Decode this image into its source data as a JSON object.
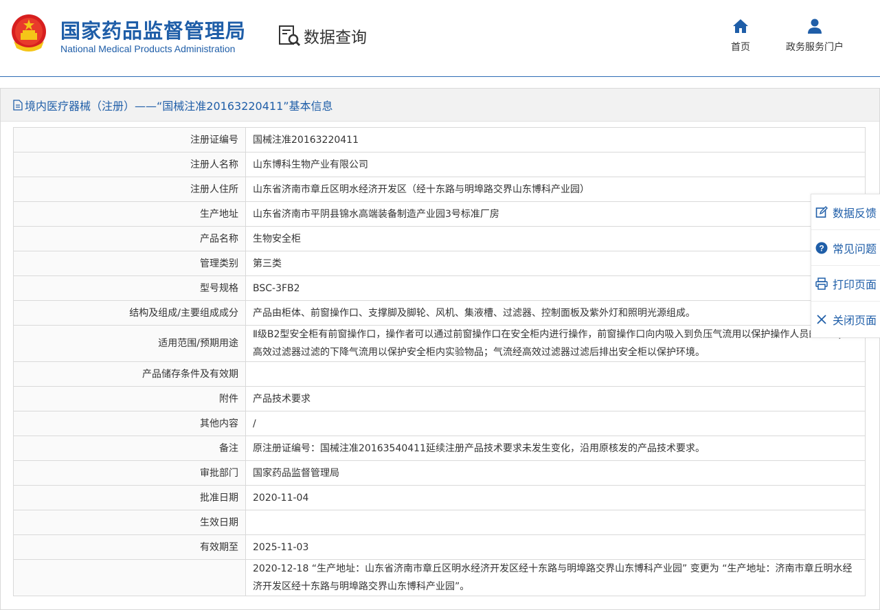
{
  "header": {
    "org_cn": "国家药品监督管理局",
    "org_en": "National Medical Products Administration",
    "query_label": "数据查询",
    "nav": [
      {
        "label": "首页",
        "icon": "home-icon"
      },
      {
        "label": "政务服务门户",
        "icon": "user-icon"
      }
    ]
  },
  "panel": {
    "title": "境内医疗器械（注册）——“国械注准20163220411”基本信息"
  },
  "rows": [
    {
      "key": "注册证编号",
      "value": "国械注准20163220411"
    },
    {
      "key": "注册人名称",
      "value": "山东博科生物产业有限公司"
    },
    {
      "key": "注册人住所",
      "value": "山东省济南市章丘区明水经济开发区（经十东路与明埠路交界山东博科产业园）"
    },
    {
      "key": "生产地址",
      "value": "山东省济南市平阴县锦水高端装备制造产业园3号标准厂房"
    },
    {
      "key": "产品名称",
      "value": "生物安全柜"
    },
    {
      "key": "管理类别",
      "value": "第三类"
    },
    {
      "key": "型号规格",
      "value": "BSC-3FB2"
    },
    {
      "key": "结构及组成/主要组成成分",
      "value": "产品由柜体、前窗操作口、支撑脚及脚轮、风机、集液槽、过滤器、控制面板及紫外灯和照明光源组成。"
    },
    {
      "key": "适用范围/预期用途",
      "value": "Ⅱ级B2型安全柜有前窗操作口，操作者可以通过前窗操作口在安全柜内进行操作，前窗操作口向内吸入到负压气流用以保护操作人员的安全；经高效过滤器过滤的下降气流用以保护安全柜内实验物品；气流经高效过滤器过滤后排出安全柜以保护环境。"
    },
    {
      "key": "产品储存条件及有效期",
      "value": ""
    },
    {
      "key": "附件",
      "value": "产品技术要求"
    },
    {
      "key": "其他内容",
      "value": "/"
    },
    {
      "key": "备注",
      "value": "原注册证编号：国械注准20163540411延续注册产品技术要求未发生变化，沿用原核发的产品技术要求。"
    },
    {
      "key": "审批部门",
      "value": "国家药品监督管理局"
    },
    {
      "key": "批准日期",
      "value": "2020-11-04"
    },
    {
      "key": "生效日期",
      "value": ""
    },
    {
      "key": "有效期至",
      "value": "2025-11-03"
    },
    {
      "key": "",
      "value": "2020-12-18 “生产地址：山东省济南市章丘区明水经济开发区经十东路与明埠路交界山东博科产业园” 变更为 “生产地址：济南市章丘明水经济开发区经十东路与明埠路交界山东博科产业园”。"
    }
  ],
  "side": [
    {
      "label": "数据反馈",
      "icon": "edit-icon"
    },
    {
      "label": "常见问题",
      "icon": "question-icon"
    },
    {
      "label": "打印页面",
      "icon": "print-icon"
    },
    {
      "label": "关闭页面",
      "icon": "close-icon"
    }
  ],
  "colors": {
    "brand": "#1f5ea8",
    "border": "#d9d9d9",
    "title_bg": "#f2f2f2"
  }
}
